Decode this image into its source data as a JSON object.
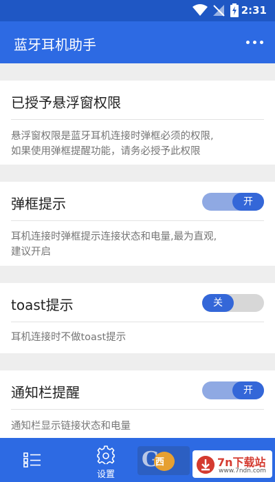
{
  "status_bar": {
    "time": "2:31"
  },
  "app_bar": {
    "title": "蓝牙耳机助手",
    "more_icon": "more-icon"
  },
  "sections": {
    "permission": {
      "title": "已授予悬浮窗权限",
      "desc_line1": "悬浮窗权限是蓝牙耳机连接时弹框必须的权限,",
      "desc_line2": "如果使用弹框提醒功能，请务必授予此权限"
    },
    "popup": {
      "title": "弹框提示",
      "switch_label": "开",
      "enabled": true,
      "desc_line1": "耳机连接时弹框提示连接状态和电量,最为直观,",
      "desc_line2": "建议开启"
    },
    "toast": {
      "title": "toast提示",
      "switch_label": "关",
      "enabled": false,
      "desc_line1": "耳机连接时不做toast提示"
    },
    "notification": {
      "title": "通知栏提醒",
      "switch_label": "开",
      "enabled": true,
      "desc_line1": "通知栏显示链接状态和电量"
    }
  },
  "bottom_nav": {
    "items": [
      {
        "icon": "list-icon",
        "label": ""
      },
      {
        "icon": "gear-icon",
        "label": "设置"
      }
    ]
  },
  "watermark": {
    "site_name": "7n下载站",
    "site_url": "www.7ndn.com",
    "badge_text": "西"
  },
  "colors": {
    "status_bar": "#1f57c4",
    "primary": "#2d6ae3",
    "switch_knob": "#3467d8",
    "switch_track_on": "#8fa9e3",
    "switch_track_off": "#d7d7d7"
  }
}
